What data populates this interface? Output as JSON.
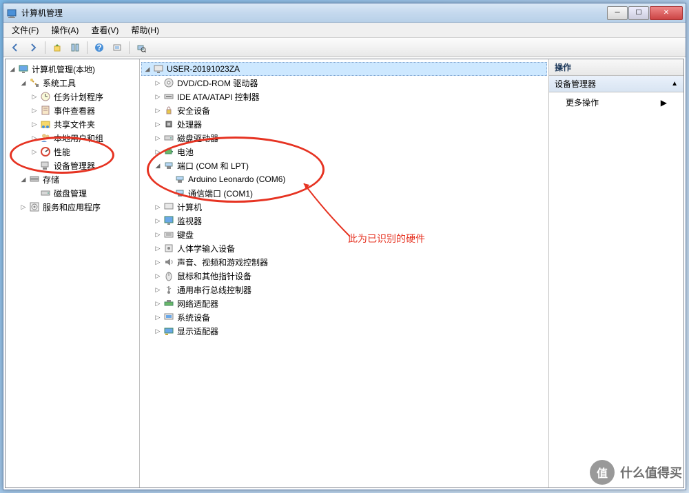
{
  "window": {
    "title": "计算机管理"
  },
  "menu": {
    "file": "文件(F)",
    "action": "操作(A)",
    "view": "查看(V)",
    "help": "帮助(H)"
  },
  "leftTree": {
    "root": "计算机管理(本地)",
    "systemTools": "系统工具",
    "taskScheduler": "任务计划程序",
    "eventViewer": "事件查看器",
    "sharedFolders": "共享文件夹",
    "localUsers": "本地用户和组",
    "performance": "性能",
    "deviceManager": "设备管理器",
    "storage": "存储",
    "diskManagement": "磁盘管理",
    "services": "服务和应用程序"
  },
  "deviceTree": {
    "computer": "USER-20191023ZA",
    "dvd": "DVD/CD-ROM 驱动器",
    "ide": "IDE ATA/ATAPI 控制器",
    "security": "安全设备",
    "cpu": "处理器",
    "disk": "磁盘驱动器",
    "battery": "电池",
    "ports": "端口 (COM 和 LPT)",
    "arduino": "Arduino Leonardo (COM6)",
    "com1": "通信端口 (COM1)",
    "computers": "计算机",
    "monitor": "监视器",
    "keyboard": "键盘",
    "hid": "人体学输入设备",
    "sound": "声音、视频和游戏控制器",
    "mouse": "鼠标和其他指针设备",
    "usb": "通用串行总线控制器",
    "network": "网络适配器",
    "system": "系统设备",
    "display": "显示适配器"
  },
  "rightPane": {
    "header": "操作",
    "section": "设备管理器",
    "moreActions": "更多操作"
  },
  "annotation": {
    "text": "此为已识别的硬件"
  },
  "watermark": {
    "logo": "值",
    "text": "什么值得买"
  }
}
